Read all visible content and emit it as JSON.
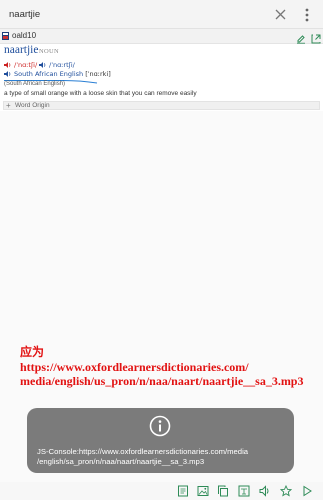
{
  "search": {
    "value": "naartjie"
  },
  "icons": {
    "clear": "close-icon",
    "menu": "more-vert-icon",
    "edit": "pencil-icon",
    "expand": "expand-icon",
    "speaker": "speaker-icon",
    "info": "info-icon"
  },
  "dictionary": {
    "name": "oald10"
  },
  "entry": {
    "headword": "naartjie",
    "pos": "NOUN",
    "pron_br": "/ˈnɑːtʃi/",
    "pron_us": "/ˈnɑːrtʃi/",
    "sa_label": "South African English",
    "sa_ipa": "[ˈnɑːrki]",
    "region": "(South African English)",
    "definition": "a type of small orange with a loose skin that you can remove easily",
    "word_origin_label": "Word Origin"
  },
  "note": {
    "lines": [
      "应为",
      "https://www.oxfordlearnersdictionaries.com/",
      "media/english/us_pron/n/naa/naart/naartjie__sa_3.mp3"
    ]
  },
  "toast": {
    "lines": [
      "JS-Console:https://www.oxfordlearnersdictionaries.com/media",
      "/english/sa_pron/n/naa/naart/naartjie__sa_3.mp3"
    ]
  },
  "bottom_bar": {
    "icons": [
      "dictionary-icon",
      "image-icon",
      "copy-icon",
      "translate-icon",
      "volume-icon",
      "star-icon",
      "play-icon"
    ]
  },
  "colors": {
    "link_blue": "#1f4e9c",
    "pron_red": "#cc2222",
    "note_red": "#e21212",
    "toast_bg": "#7b7b7b",
    "accent_green": "#2e8b57"
  }
}
